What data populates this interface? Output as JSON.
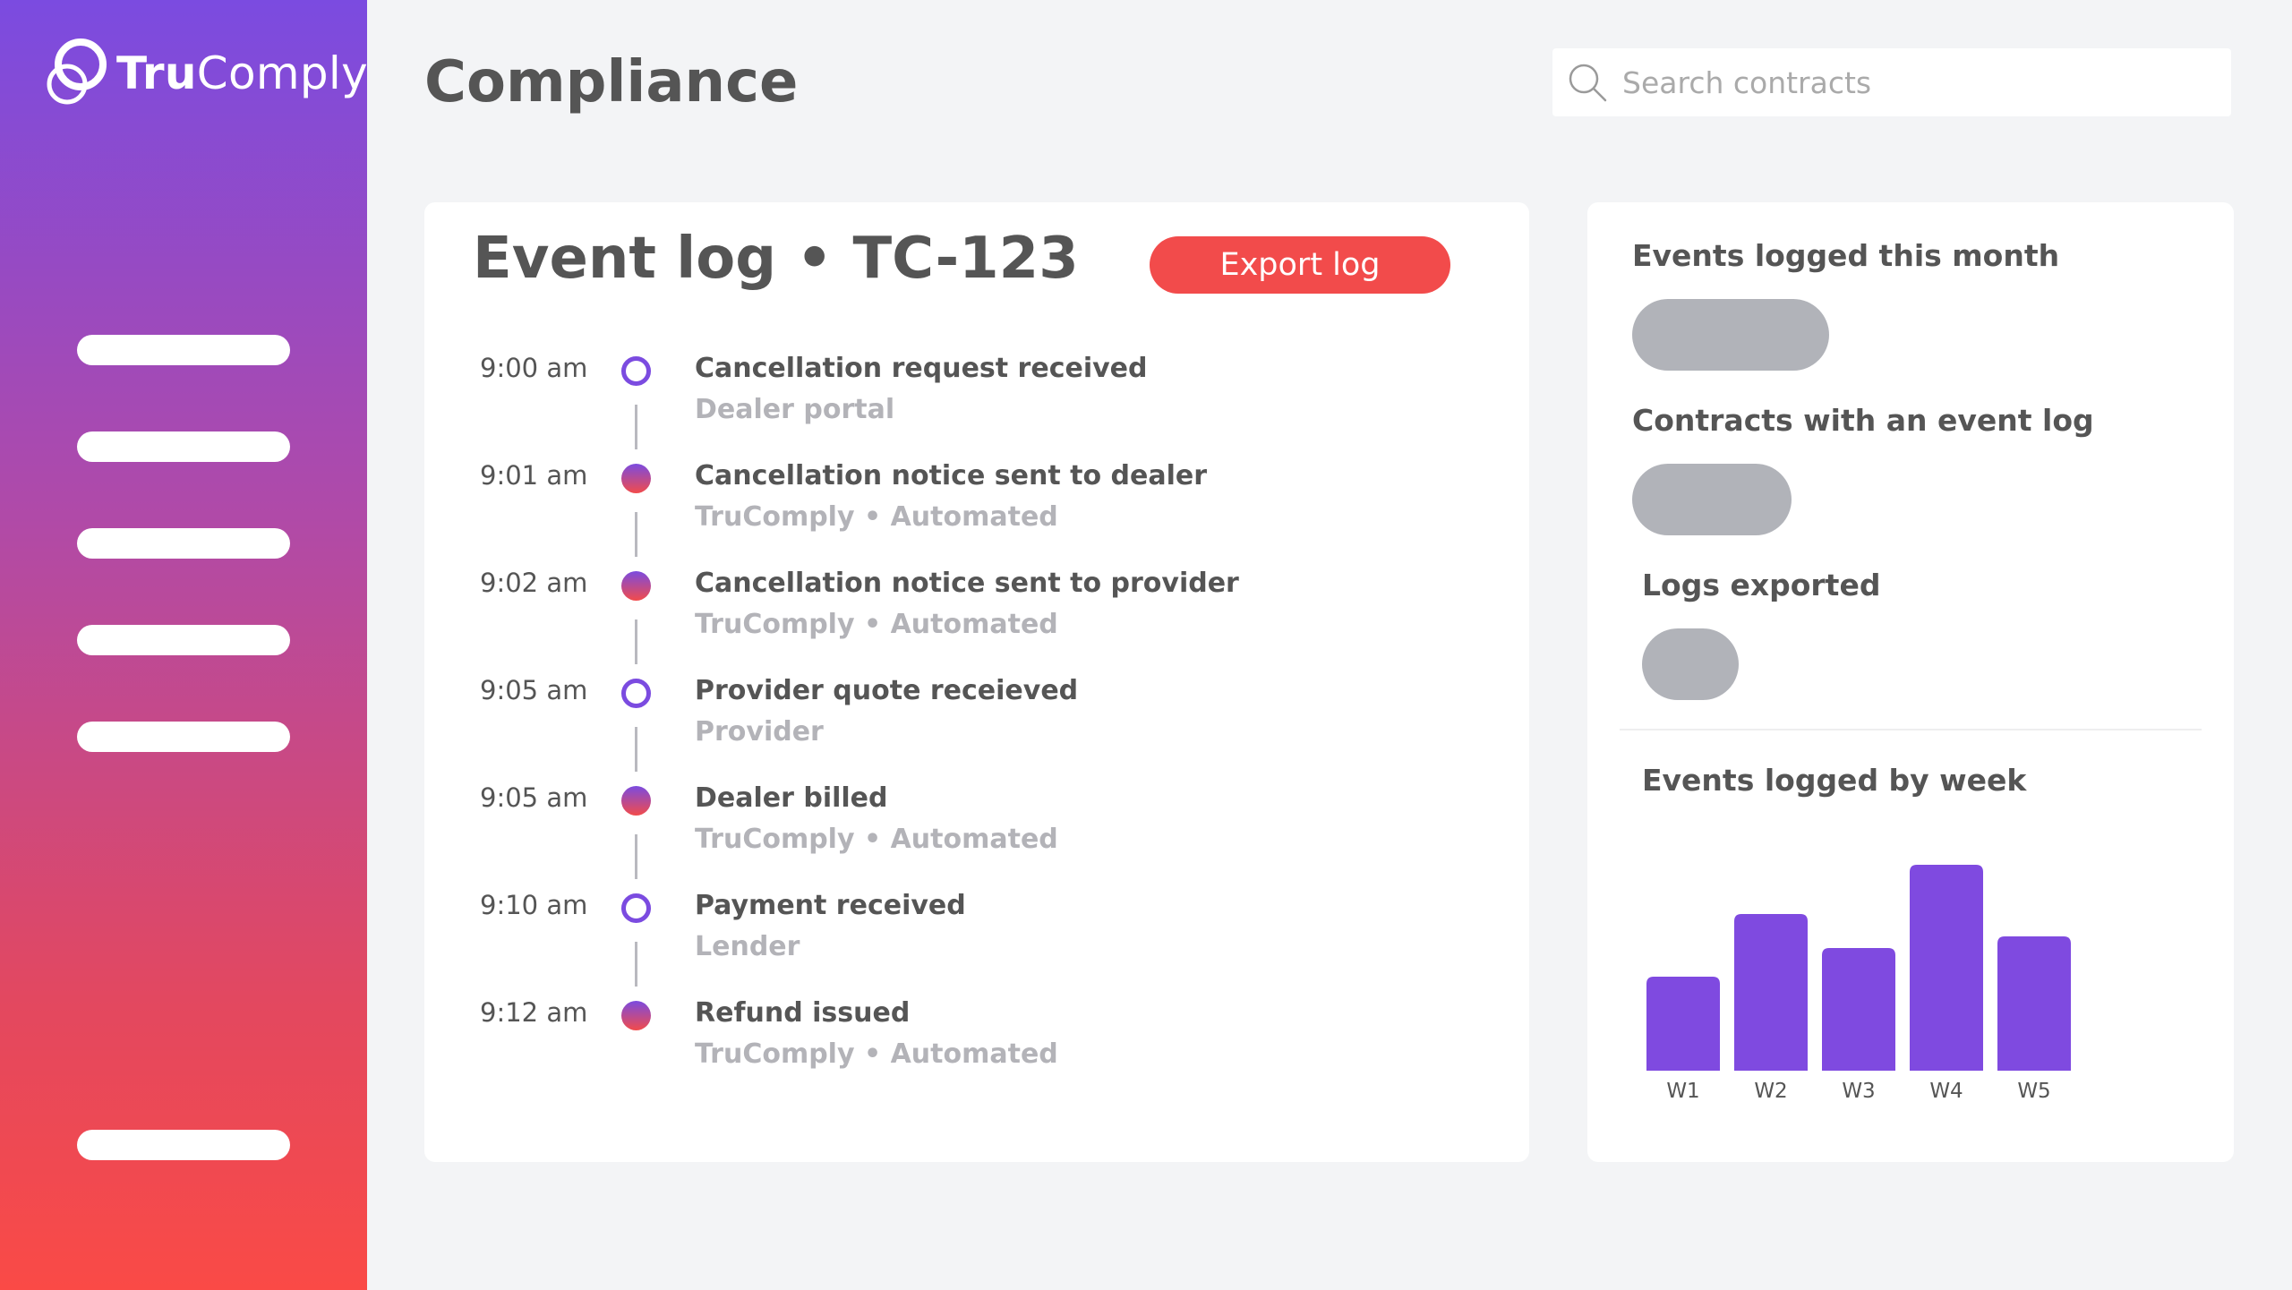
{
  "app": {
    "brand_bold": "Tru",
    "brand_rest": "Comply"
  },
  "sidebar": {
    "nav_placeholders": 5,
    "footer_placeholder": 1
  },
  "header": {
    "title": "Compliance",
    "search_placeholder": "Search contracts"
  },
  "event_log": {
    "title": "Event log • TC-123",
    "export_label": "Export log",
    "events": [
      {
        "time": "9:00 am",
        "title": "Cancellation request received",
        "source": "Dealer portal",
        "marker": "hollow"
      },
      {
        "time": "9:01 am",
        "title": "Cancellation notice sent to dealer",
        "source": "TruComply • Automated",
        "marker": "filled"
      },
      {
        "time": "9:02 am",
        "title": "Cancellation notice sent to provider",
        "source": "TruComply • Automated",
        "marker": "filled"
      },
      {
        "time": "9:05 am",
        "title": "Provider quote receieved",
        "source": "Provider",
        "marker": "hollow"
      },
      {
        "time": "9:05 am",
        "title": "Dealer billed",
        "source": "TruComply • Automated",
        "marker": "filled"
      },
      {
        "time": "9:10 am",
        "title": "Payment received",
        "source": "Lender",
        "marker": "hollow"
      },
      {
        "time": "9:12 am",
        "title": "Refund issued",
        "source": "TruComply • Automated",
        "marker": "filled"
      }
    ]
  },
  "stats": {
    "events_month_label": "Events logged this month",
    "contracts_label": "Contracts with an event log",
    "exported_label": "Logs exported",
    "chart_title": "Events logged by week"
  },
  "colors": {
    "accent_purple": "#7b4be0",
    "accent_red": "#f24b4b",
    "placeholder_gray": "#b1b3b9",
    "bar": "#7f4ae0"
  },
  "chart_data": {
    "type": "bar",
    "title": "Events logged by week",
    "categories": [
      "W1",
      "W2",
      "W3",
      "W4",
      "W5"
    ],
    "values": [
      105,
      175,
      137,
      230,
      150
    ],
    "ylim": [
      0,
      230
    ],
    "grid": false,
    "legend": "none"
  }
}
